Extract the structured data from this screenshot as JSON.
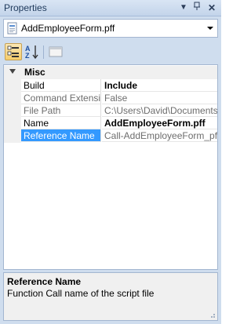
{
  "window": {
    "title": "Properties"
  },
  "titlebar_buttons": [
    "dropdown-icon",
    "pin-icon",
    "close-icon"
  ],
  "object_selector": {
    "value": "AddEmployeeForm.pff"
  },
  "toolbar": {
    "tools": [
      "categorized-icon",
      "alphabetical-icon",
      "property-pages-icon"
    ]
  },
  "grid": {
    "category": "Misc",
    "rows": [
      {
        "name": "Build",
        "value": "Include"
      },
      {
        "name": "Command Extension",
        "value": "False"
      },
      {
        "name": "File Path",
        "value": "C:\\Users\\David\\Documents\\S"
      },
      {
        "name": "Name",
        "value": "AddEmployeeForm.pff"
      },
      {
        "name": "Reference Name",
        "value": "Call-AddEmployeeForm_pff"
      }
    ]
  },
  "description": {
    "title": "Reference Name",
    "text": "Function Call name of the script file"
  },
  "colors": {
    "selection": "#3399ff",
    "panel": "#cfddee"
  }
}
